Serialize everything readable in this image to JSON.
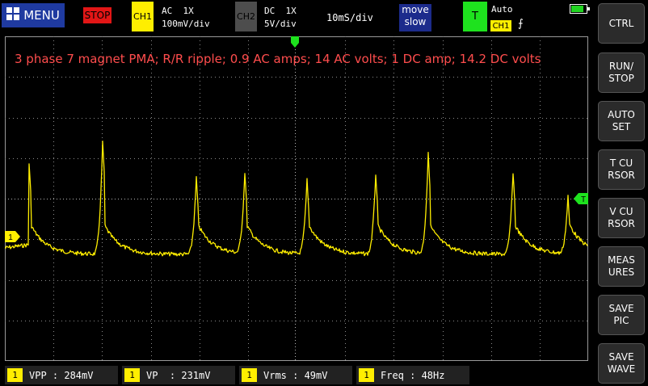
{
  "top_bar": {
    "menu_label": "MENU",
    "run_state": "STOP",
    "ch1": {
      "label": "CH1",
      "coupling": "AC",
      "probe": "1X",
      "scale": "100mV/div"
    },
    "ch2": {
      "label": "CH2",
      "coupling": "DC",
      "probe": "1X",
      "scale": "5V/div"
    },
    "timebase": "10mS/div",
    "move": {
      "line1": "move",
      "line2": "slow"
    },
    "trigger": {
      "label": "T",
      "mode": "Auto",
      "source": "CH1",
      "edge": "⨍"
    },
    "battery_level": 0.85
  },
  "screen": {
    "caption": "3 phase 7 magnet PMA; R/R ripple; 0.9 AC amps; 14 AC volts; 1 DC amp; 14.2 DC volts",
    "ch1_marker": "1",
    "trigger_marker": "T"
  },
  "side_buttons": [
    {
      "label": "CTRL"
    },
    {
      "label": "RUN/\nSTOP"
    },
    {
      "label": "AUTO\nSET"
    },
    {
      "label": "T CU\nRSOR"
    },
    {
      "label": "V CU\nRSOR"
    },
    {
      "label": "MEAS\nURES"
    },
    {
      "label": "SAVE\nPIC"
    },
    {
      "label": "SAVE\nWAVE"
    }
  ],
  "measurements": [
    {
      "ch": "1",
      "text": "VPP : 284mV"
    },
    {
      "ch": "1",
      "text": "VP  : 231mV"
    },
    {
      "ch": "1",
      "text": "Vrms : 49mV"
    },
    {
      "ch": "1",
      "text": "Freq : 48Hz"
    }
  ],
  "colors": {
    "trace": "#ffee00",
    "grid": "#9a9a9a",
    "caption": "#ff4d4d",
    "trigger": "#1ee21e"
  }
}
